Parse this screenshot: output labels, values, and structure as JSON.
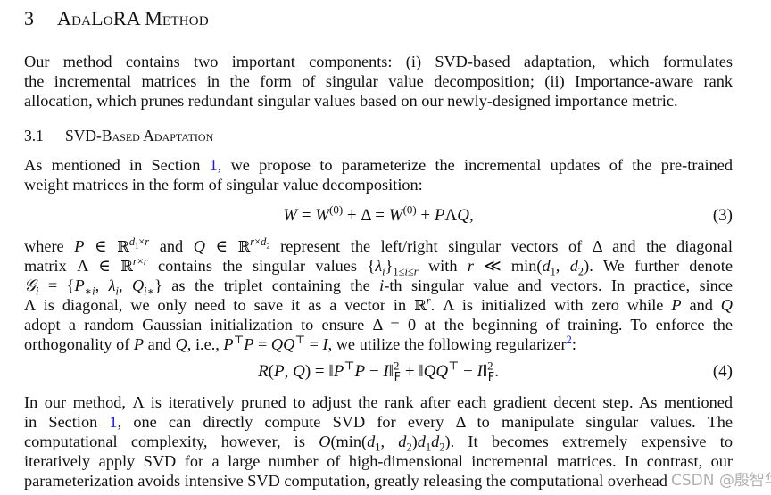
{
  "section": {
    "number": "3",
    "title": "AdaLoRA Method"
  },
  "intro": {
    "lines": [
      "Our method contains two important components: (i) SVD-based adaptation, which formulates",
      "the incremental matrices in the form of singular value decomposition; (ii) Importance-aware rank",
      "allocation, which prunes redundant singular values based on our newly-designed importance metric."
    ]
  },
  "subsection": {
    "number": "3.1",
    "title": "SVD-Based Adaptation"
  },
  "para1": {
    "line1_a": "As mentioned in Section ",
    "line1_link": "1",
    "line1_b": ", we propose to parameterize the incremental updates of the pre-trained",
    "line2": "weight matrices in the form of singular value decomposition:"
  },
  "equation3": {
    "text": "W = W(0) + Δ = W(0) + PΛQ,",
    "tag": "(3)"
  },
  "para2": {
    "l1_a": "where ",
    "l1_b": " and ",
    "l1_c": " represent the left/right singular vectors of Δ and the diagonal",
    "l2_a": "matrix ",
    "l2_b": " contains the singular values ",
    "l2_c": " with ",
    "l2_d": ". We further denote",
    "l3_b": " as the triplet containing the ",
    "l3_c": "-th singular value and vectors. In practice, since",
    "l4_a": "Λ is diagonal, we only need to save it as a vector in ",
    "l4_b": ". Λ is initialized with zero while ",
    "l4_c": " and ",
    "l5_a": "adopt a random Gaussian initialization to ensure Δ = 0 at the beginning of training. To enforce the",
    "l6_a": "orthogonality of ",
    "l6_b": " and ",
    "l6_c": ", i.e., ",
    "l6_d": ", we utilize the following regularizer",
    "l6_fn": "2",
    "l6_e": ":"
  },
  "equation4": {
    "text": "R(P, Q) = ‖PᵀP − I‖²_F + ‖QQᵀ − I‖²_F.",
    "tag": "(4)"
  },
  "para3": {
    "line1": "In our method, Λ is iteratively pruned to adjust the rank after each gradient decent step. As mentioned",
    "line2_a": "in Section ",
    "line2_link": "1",
    "line2_b": ", one can directly compute SVD for every Δ to manipulate singular values.  The",
    "line3_a": "computational complexity, however, is ",
    "line3_b": ". It becomes extremely expensive to",
    "line4": "iteratively apply SVD for a large number of high-dimensional incremental matrices. In contrast, our",
    "line5": "parameterization avoids intensive SVD computation, greatly releasing the computational overhead"
  },
  "watermark": "CSDN @殷智华",
  "colors": {
    "link": "#1a1ae6",
    "text": "#111111"
  }
}
